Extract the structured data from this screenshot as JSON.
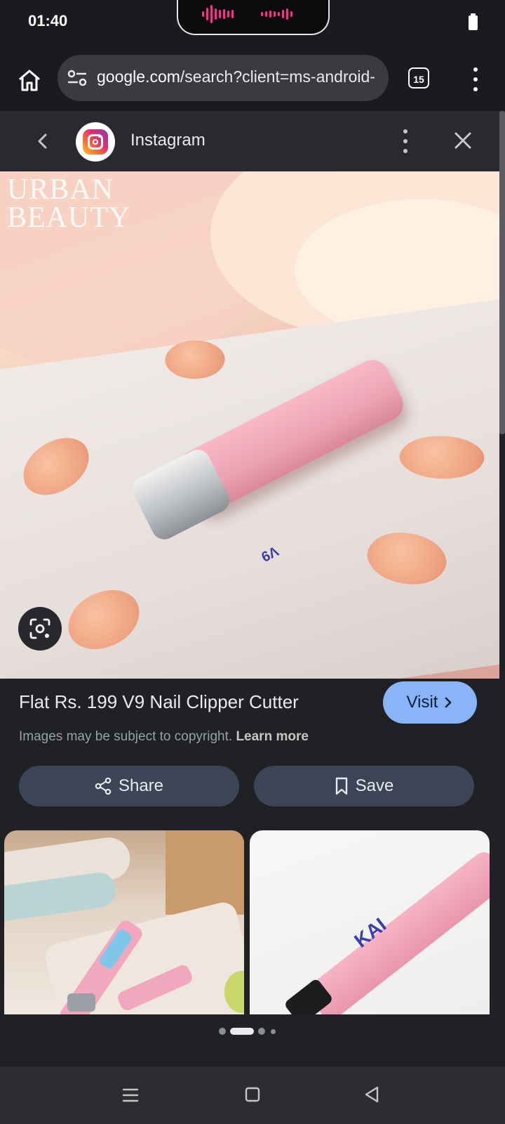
{
  "status": {
    "time": "01:40"
  },
  "browser": {
    "url_domain": "google.com",
    "url_rest": "/search?client=ms-android-",
    "tab_count": "15"
  },
  "panel": {
    "source": "Instagram",
    "image_watermark": "URBAN\nBEAUTY",
    "result_title": "Flat Rs. 199 V9 Nail Clipper Cutter",
    "visit_label": "Visit",
    "copyright_text": "Images may be subject to copyright.",
    "learn_more": "Learn more",
    "share_label": "Share",
    "save_label": "Save",
    "product_logo_text": "V9",
    "thumb2_logo_text": "KAI"
  },
  "pager": {
    "count": 4,
    "active_index": 1
  },
  "colors": {
    "accent": "#8ab4f8",
    "pill_bg": "#3c4556",
    "panel_bg": "#202124"
  },
  "icons": [
    "home-icon",
    "site-settings-icon",
    "tabs-icon",
    "more-vert-icon",
    "chevron-left-icon",
    "instagram-icon",
    "close-icon",
    "lens-icon",
    "chevron-right-icon",
    "share-icon",
    "bookmark-icon",
    "recents-icon",
    "home-nav-icon",
    "back-nav-icon"
  ]
}
